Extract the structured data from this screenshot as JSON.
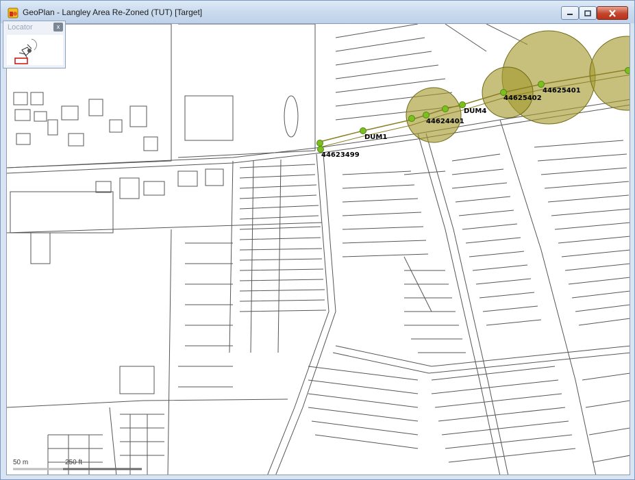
{
  "window": {
    "title": "GeoPlan - Langley Area Re-Zoned (TUT) [Target]",
    "controls": {
      "minimize": "minimize",
      "maximize": "maximize",
      "close": "close"
    }
  },
  "locator": {
    "title": "Locator",
    "close_label": "x"
  },
  "scale": {
    "metric": "50 m",
    "imperial": "250 ft"
  },
  "nodes": [
    {
      "id": "44623499"
    },
    {
      "id": "DUM1"
    },
    {
      "id": "44624401"
    },
    {
      "id": "DUM4"
    },
    {
      "id": "44625402"
    },
    {
      "id": "44625401"
    }
  ],
  "colors": {
    "node_fill": "#7cbf1e",
    "buffer_fill": "#a39a2c",
    "pipe": "#8a7f22",
    "map_line": "#444444"
  }
}
